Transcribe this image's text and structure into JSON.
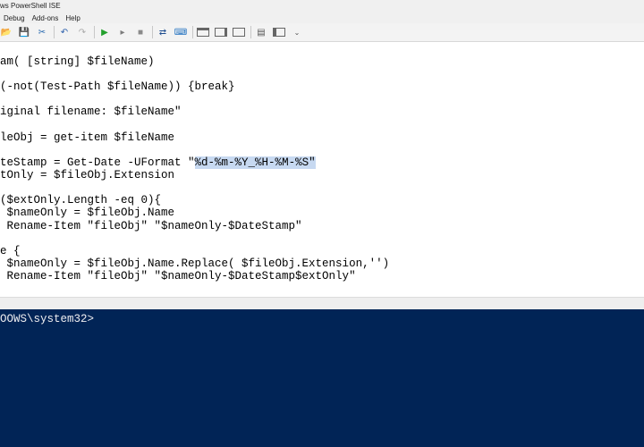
{
  "window": {
    "title": "ws PowerShell ISE"
  },
  "menu": [
    "Debug",
    "Add-ons",
    "Help"
  ],
  "toolbar": {
    "open_label": "📂",
    "save_label": "💾",
    "cut_label": "✂",
    "copy_label": "⧉",
    "undo_label": "↶",
    "redo_label": "↷",
    "run_label": "▶",
    "run_selection_label": "▸",
    "stop_label": "■",
    "remote_label": "⇄",
    "console_label": "⌨",
    "snippet_label": "▤",
    "more_label": "⌄"
  },
  "editor": {
    "lines": [
      {
        "code": "am( [string] $fileName)"
      },
      {
        "code": "(-not(Test-Path $fileName)) {break}"
      },
      {
        "code": "iginal filename: $fileName\""
      },
      {
        "code": "leObj = get-item $fileName"
      },
      {
        "pre": "teStamp = Get-Date -UFormat \"",
        "sel": "%d-%m-%Y_%H-%M-%S\""
      },
      {
        "code": "tOnly = $fileObj.Extension"
      },
      {
        "code": "($extOnly.Length -eq 0){"
      },
      {
        "code": " $nameOnly = $fileObj.Name"
      },
      {
        "code": " Rename-Item \"fileObj\" \"$nameOnly-$DateStamp\""
      },
      {
        "code": "e {"
      },
      {
        "code": " $nameOnly = $fileObj.Name.Replace( $fileObj.Extension,'')"
      },
      {
        "code": " Rename-Item \"fileObj\" \"$nameOnly-$DateStamp$extOnly\""
      }
    ]
  },
  "console": {
    "prompt": "OOWS\\system32>"
  },
  "colors": {
    "console_bg": "#012456",
    "selection": "#c7d9f1"
  },
  "icons": [
    "open-icon",
    "save-icon",
    "cut-icon",
    "copy-icon",
    "undo-icon",
    "redo-icon",
    "run-icon",
    "run-selection-icon",
    "stop-icon",
    "remote-icon",
    "console-icon"
  ]
}
